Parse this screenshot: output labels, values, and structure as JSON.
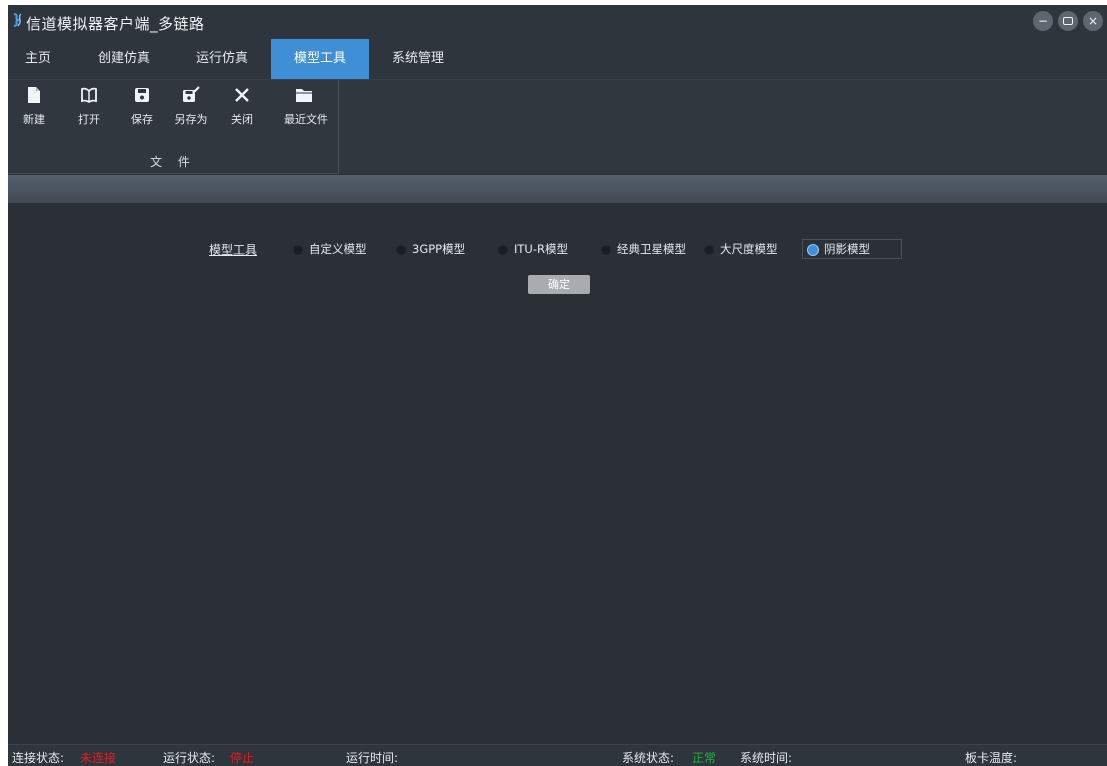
{
  "window": {
    "title": "信道模拟器客户端_多链路",
    "controls": [
      "minimize",
      "maximize",
      "close"
    ]
  },
  "menu": {
    "tabs": [
      {
        "label": "主页",
        "active": false
      },
      {
        "label": "创建仿真",
        "active": false
      },
      {
        "label": "运行仿真",
        "active": false
      },
      {
        "label": "模型工具",
        "active": true
      },
      {
        "label": "系统管理",
        "active": false
      }
    ]
  },
  "ribbon": {
    "group_label": "文 件",
    "buttons": [
      {
        "label": "新建",
        "icon": "new-file-icon"
      },
      {
        "label": "打开",
        "icon": "open-book-icon"
      },
      {
        "label": "保存",
        "icon": "save-icon"
      },
      {
        "label": "另存为",
        "icon": "save-as-icon"
      },
      {
        "label": "关闭",
        "icon": "close-icon"
      },
      {
        "label": "最近文件",
        "icon": "folder-icon"
      }
    ]
  },
  "model_tool": {
    "label": "模型工具",
    "options": [
      {
        "label": "自定义模型",
        "checked": false
      },
      {
        "label": "3GPP模型",
        "checked": false
      },
      {
        "label": "ITU-R模型",
        "checked": false
      },
      {
        "label": "经典卫星模型",
        "checked": false
      },
      {
        "label": "大尺度模型",
        "checked": false
      },
      {
        "label": "阴影模型",
        "checked": true
      }
    ],
    "confirm_label": "确定"
  },
  "status": {
    "connection_label": "连接状态:",
    "connection_value": "未连接",
    "run_label": "运行状态:",
    "run_value": "停止",
    "run_time_label": "运行时间:",
    "system_status_label": "系统状态:",
    "system_status_value": "正常",
    "system_time_label": "系统时间:",
    "board_temp_label": "板卡温度:"
  },
  "colors": {
    "accent": "#3f8fd6",
    "background": "#2b3037",
    "status_error": "#e02020",
    "status_ok": "#22b03a"
  }
}
